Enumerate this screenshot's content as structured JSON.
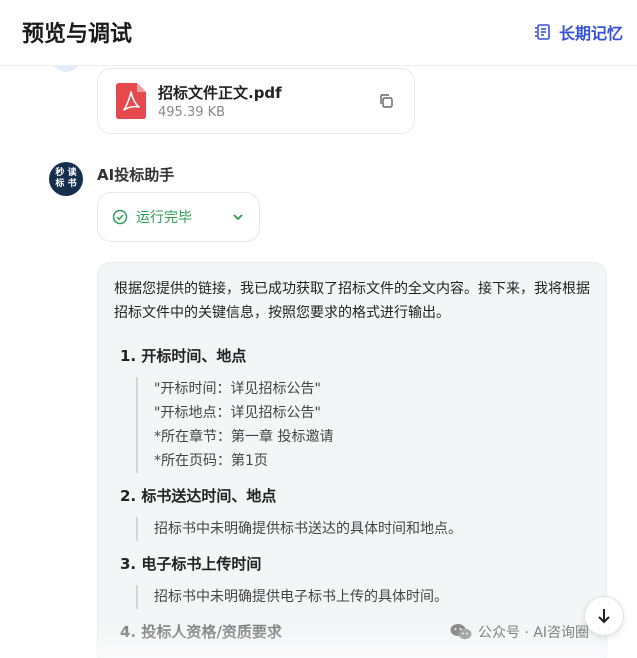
{
  "header": {
    "title": "预览与调试",
    "memory_label": "长期记忆"
  },
  "file": {
    "name": "招标文件正文.pdf",
    "size": "495.39 KB"
  },
  "bot": {
    "avatar_chars": [
      "秒",
      "读",
      "标",
      "书"
    ],
    "name": "AI投标助手"
  },
  "status": {
    "label": "运行完毕"
  },
  "answer": {
    "intro": "根据您提供的链接，我已成功获取了招标文件的全文内容。接下来，我将根据招标文件中的关键信息，按照您要求的格式进行输出。",
    "sections": [
      {
        "heading": "1. 开标时间、地点",
        "lines": [
          "\"开标时间：详见招标公告\"",
          "\"开标地点：详见招标公告\"",
          "*所在章节：第一章 投标邀请",
          "*所在页码：第1页"
        ]
      },
      {
        "heading": "2. 标书送达时间、地点",
        "lines": [
          "招标书中未明确提供标书送达的具体时间和地点。"
        ]
      },
      {
        "heading": "3. 电子标书上传时间",
        "lines": [
          "招标书中未明确提供电子标书上传的具体时间。"
        ]
      },
      {
        "heading": "4. 投标人资格/资质要求",
        "lines": []
      }
    ]
  },
  "watermark": {
    "text": "公众号 · AI咨询圈"
  },
  "colors": {
    "accent": "#3552d8",
    "success": "#2e9d55",
    "pdf_red": "#e5484d",
    "avatar_bg": "#15304f"
  }
}
